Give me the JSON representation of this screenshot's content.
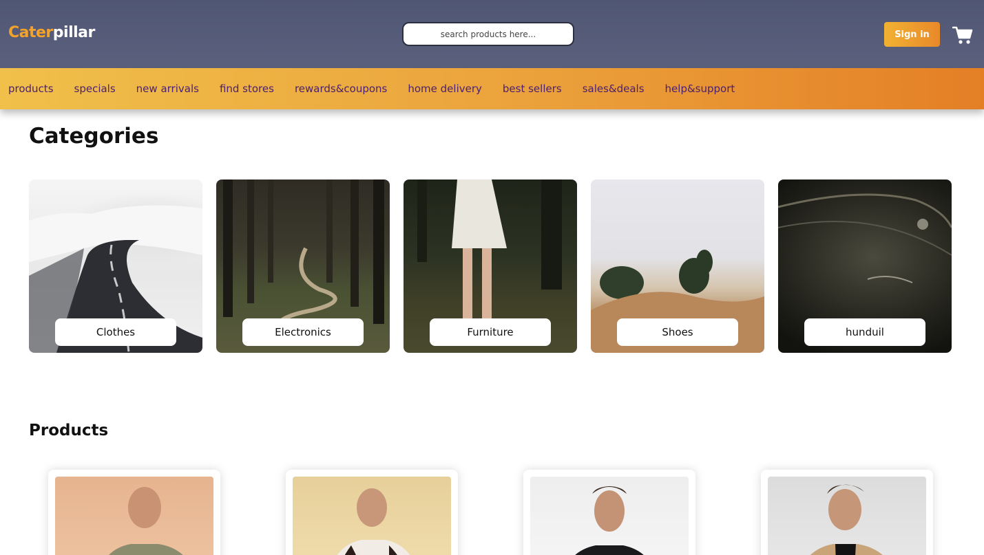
{
  "brand": {
    "part1": "Cater",
    "part2": "pillar"
  },
  "search": {
    "placeholder": "search products here..."
  },
  "header": {
    "signin_label": "Sign in"
  },
  "nav": {
    "items": [
      "products",
      "specials",
      "new arrivals",
      "find stores",
      "rewards&coupons",
      "home delivery",
      "best sellers",
      "sales&deals",
      "help&support"
    ]
  },
  "categories": {
    "title": "Categories",
    "items": [
      "Clothes",
      "Electronics",
      "Furniture",
      "Shoes",
      "hunduil"
    ]
  },
  "products": {
    "title": "Products"
  },
  "colors": {
    "header": "#555b78",
    "accent": "#f0b53a",
    "nav_text": "#4a1f6e"
  }
}
